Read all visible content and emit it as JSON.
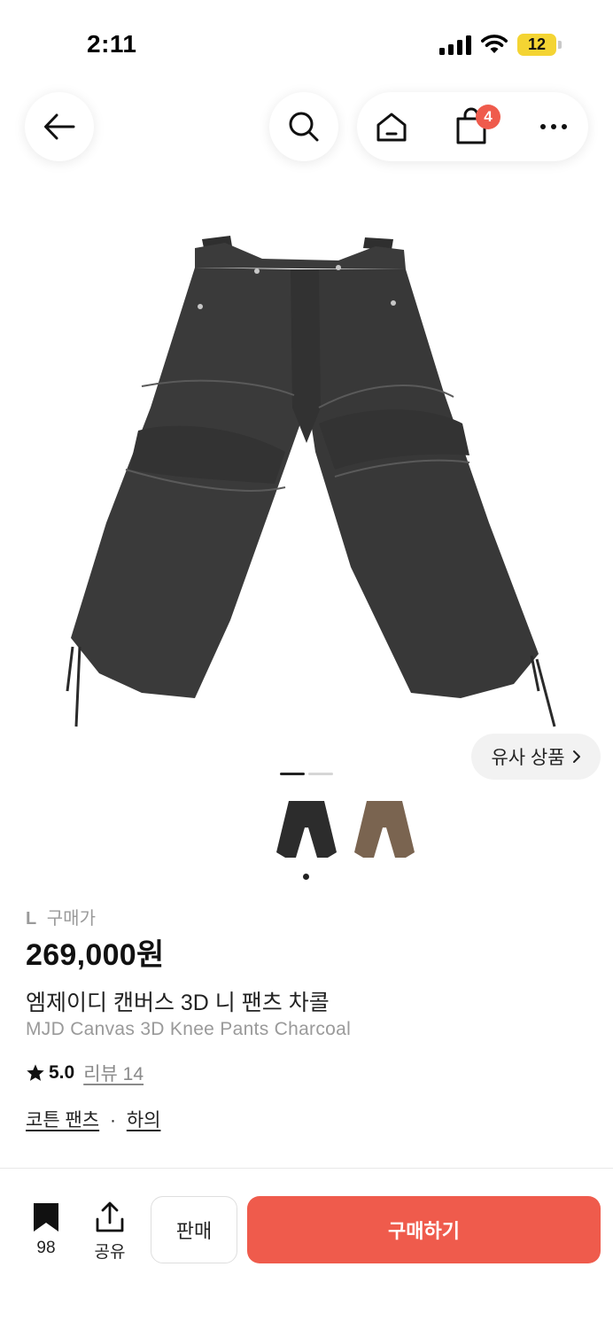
{
  "status_bar": {
    "time": "2:11",
    "battery": "12",
    "battery_color": "#f4d433"
  },
  "nav": {
    "back_icon": "arrow-left-icon",
    "search_icon": "search-icon",
    "home_icon": "home-icon",
    "cart_icon": "shopping-bag-icon",
    "cart_count": "4",
    "more_icon": "more-horizontal-icon"
  },
  "product": {
    "similar_label": "유사 상품",
    "carousel_total": 2,
    "carousel_active": 1,
    "thumbnails": [
      {
        "color_name": "charcoal",
        "color": "#2c2c2c"
      },
      {
        "color_name": "brown",
        "color": "#7a6450"
      }
    ],
    "size": "L",
    "size_suffix": "구매가",
    "price": "269,000원",
    "name_ko": "엠제이디 캔버스 3D 니 팬츠 차콜",
    "name_en": "MJD Canvas 3D Knee Pants Charcoal",
    "rating": "5.0",
    "reviews_label": "리뷰 14",
    "category_1": "코튼 팬츠",
    "category_sep": "·",
    "category_2": "하의"
  },
  "bottom_bar": {
    "bookmark_count": "98",
    "share_label": "공유",
    "sell_label": "판매",
    "buy_label": "구매하기",
    "accent_color": "#ef5b4c"
  }
}
